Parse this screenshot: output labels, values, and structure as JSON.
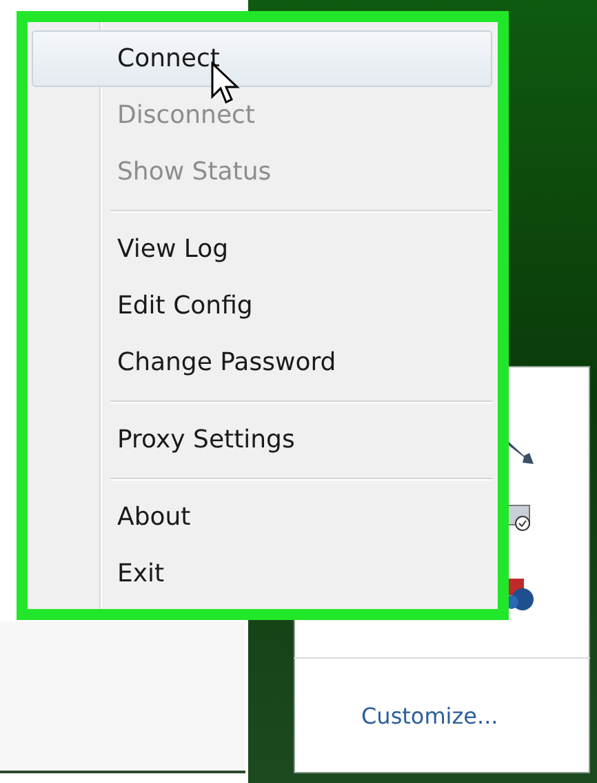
{
  "menu": {
    "items": [
      {
        "kind": "item",
        "label": "Connect",
        "selected": true,
        "disabled": false
      },
      {
        "kind": "item",
        "label": "Disconnect",
        "selected": false,
        "disabled": true
      },
      {
        "kind": "item",
        "label": "Show Status",
        "selected": false,
        "disabled": true
      },
      {
        "kind": "separator"
      },
      {
        "kind": "item",
        "label": "View Log",
        "selected": false,
        "disabled": false
      },
      {
        "kind": "item",
        "label": "Edit Config",
        "selected": false,
        "disabled": false
      },
      {
        "kind": "item",
        "label": "Change Password",
        "selected": false,
        "disabled": false
      },
      {
        "kind": "separator"
      },
      {
        "kind": "item",
        "label": "Proxy Settings",
        "selected": false,
        "disabled": false
      },
      {
        "kind": "separator"
      },
      {
        "kind": "item",
        "label": "About",
        "selected": false,
        "disabled": false
      },
      {
        "kind": "item",
        "label": "Exit",
        "selected": false,
        "disabled": false
      }
    ]
  },
  "tray_panel": {
    "customize_link": "Customize..."
  }
}
